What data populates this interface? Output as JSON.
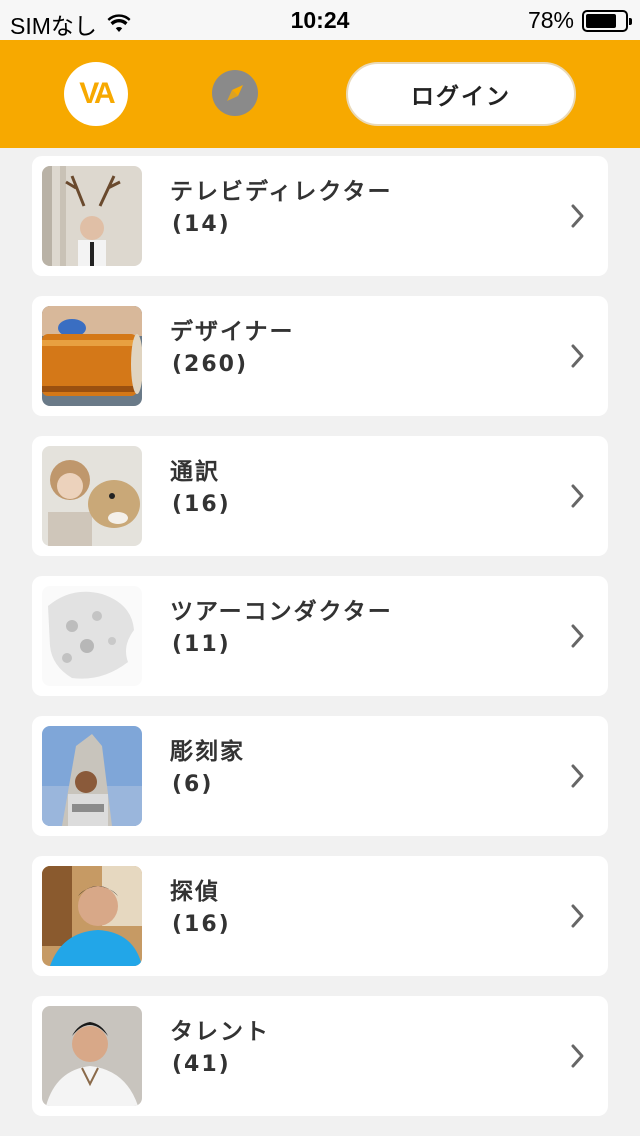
{
  "status_bar": {
    "carrier": "SIMなし",
    "time": "10:24",
    "battery_percent": "78%",
    "battery_level": 0.78
  },
  "header": {
    "logo_text": "VA",
    "login_label": "ログイン",
    "accent_color": "#f7a900"
  },
  "categories": [
    {
      "title": "テレビディレクター",
      "count": "(14)"
    },
    {
      "title": "デザイナー",
      "count": "(260)"
    },
    {
      "title": "通訳",
      "count": "(16)"
    },
    {
      "title": "ツアーコンダクター",
      "count": "(11)"
    },
    {
      "title": "彫刻家",
      "count": "(6)"
    },
    {
      "title": "探偵",
      "count": "(16)"
    },
    {
      "title": "タレント",
      "count": "(41)"
    }
  ],
  "icons": {
    "wifi": "wifi-icon",
    "battery": "battery-icon",
    "compass": "compass-icon",
    "chevron": "chevron-right-icon"
  }
}
